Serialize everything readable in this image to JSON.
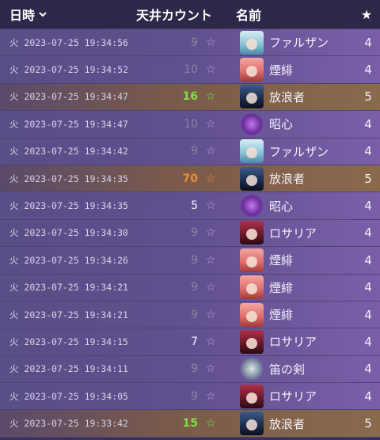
{
  "header": {
    "date_label": "日時",
    "sort_icon": "chevron-down-icon",
    "count_label": "天井カウント",
    "name_label": "名前",
    "rarity_icon": "★"
  },
  "colors": {
    "count_high": "#7fe04a",
    "count_warm": "#f08a3a",
    "count_normal_5": "#f4f2fa",
    "count_dim": "#8a86a0",
    "row_4star": "#5e4f8e",
    "row_5star": "#7a5a4a"
  },
  "rows": [
    {
      "date": "火 2023-07-25 19:34:56",
      "count": "9",
      "mark": "☆",
      "name": "ファルザン",
      "rarity": "4",
      "avatar": "faruzan-avatar"
    },
    {
      "date": "火 2023-07-25 19:34:52",
      "count": "10",
      "mark": "☆",
      "name": "煙緋",
      "rarity": "4",
      "avatar": "yanfei-avatar"
    },
    {
      "date": "火 2023-07-25 19:34:47",
      "count": "16",
      "mark": "☆",
      "name": "放浪者",
      "rarity": "5",
      "avatar": "wanderer-avatar"
    },
    {
      "date": "火 2023-07-25 19:34:47",
      "count": "10",
      "mark": "☆",
      "name": "昭心",
      "rarity": "4",
      "avatar": "zhaoxin-icon"
    },
    {
      "date": "火 2023-07-25 19:34:42",
      "count": "9",
      "mark": "☆",
      "name": "ファルザン",
      "rarity": "4",
      "avatar": "faruzan-avatar"
    },
    {
      "date": "火 2023-07-25 19:34:35",
      "count": "70",
      "mark": "☆",
      "name": "放浪者",
      "rarity": "5",
      "avatar": "wanderer-avatar"
    },
    {
      "date": "火 2023-07-25 19:34:35",
      "count": "5",
      "mark": "☆",
      "name": "昭心",
      "rarity": "4",
      "avatar": "zhaoxin-icon"
    },
    {
      "date": "火 2023-07-25 19:34:30",
      "count": "9",
      "mark": "☆",
      "name": "ロサリア",
      "rarity": "4",
      "avatar": "rosaria-avatar"
    },
    {
      "date": "火 2023-07-25 19:34:26",
      "count": "9",
      "mark": "☆",
      "name": "煙緋",
      "rarity": "4",
      "avatar": "yanfei-avatar"
    },
    {
      "date": "火 2023-07-25 19:34:21",
      "count": "9",
      "mark": "☆",
      "name": "煙緋",
      "rarity": "4",
      "avatar": "yanfei-avatar"
    },
    {
      "date": "火 2023-07-25 19:34:21",
      "count": "9",
      "mark": "☆",
      "name": "煙緋",
      "rarity": "4",
      "avatar": "yanfei-avatar"
    },
    {
      "date": "火 2023-07-25 19:34:15",
      "count": "7",
      "mark": "☆",
      "name": "ロサリア",
      "rarity": "4",
      "avatar": "rosaria-avatar"
    },
    {
      "date": "火 2023-07-25 19:34:11",
      "count": "9",
      "mark": "☆",
      "name": "笛の剣",
      "rarity": "4",
      "avatar": "flute-sword-icon"
    },
    {
      "date": "火 2023-07-25 19:34:05",
      "count": "9",
      "mark": "☆",
      "name": "ロサリア",
      "rarity": "4",
      "avatar": "rosaria-avatar"
    },
    {
      "date": "火 2023-07-25 19:33:42",
      "count": "15",
      "mark": "☆",
      "name": "放浪者",
      "rarity": "5",
      "avatar": "wanderer-avatar"
    }
  ]
}
